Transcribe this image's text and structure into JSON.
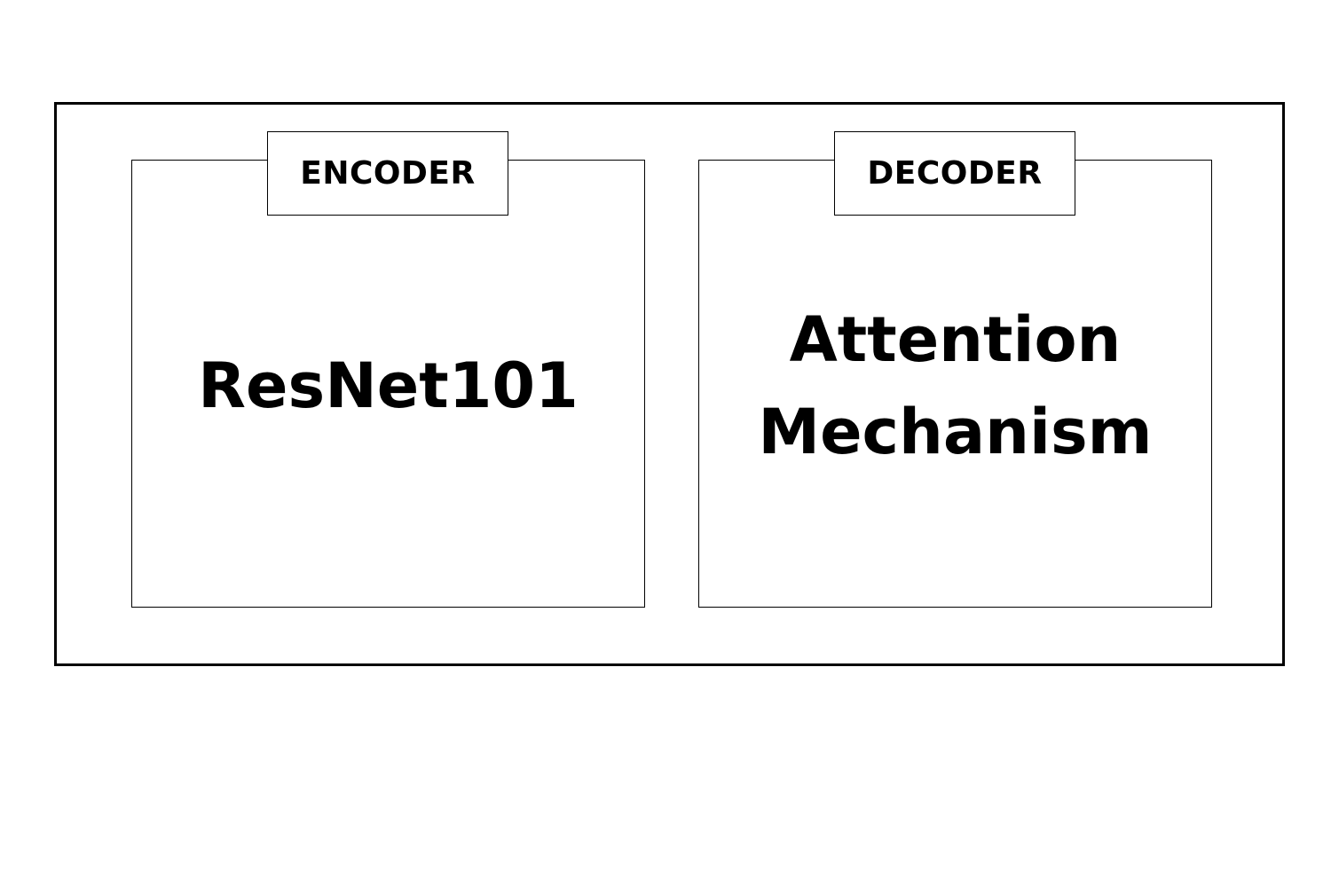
{
  "encoder": {
    "label": "ENCODER",
    "content": "ResNet101"
  },
  "decoder": {
    "label": "DECODER",
    "content_line1": "Attention",
    "content_line2": "Mechanism"
  },
  "colors": {
    "background": "#ffffff",
    "stroke": "#000000",
    "text": "#000000"
  }
}
